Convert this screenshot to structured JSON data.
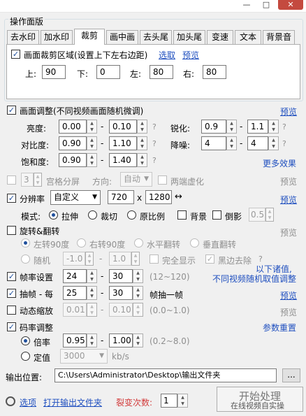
{
  "window": {
    "min": "—",
    "max": "□",
    "close": "✕"
  },
  "group_title": "操作面版",
  "tabs": [
    "去水印",
    "加水印",
    "裁剪",
    "画中画",
    "去头尾",
    "加头尾",
    "变速",
    "文本",
    "背景音"
  ],
  "crop": {
    "label": "画面裁剪区域(设置上下左右边距)",
    "select": "选取",
    "preview": "预览",
    "top_label": "上:",
    "top": "90",
    "bottom_label": "下:",
    "bottom": "0",
    "left_label": "左:",
    "left": "80",
    "right_label": "右:",
    "right": "80"
  },
  "adjust": {
    "label": "画面调整(不同视频画面随机微调)",
    "preview": "预览",
    "brightness_label": "亮度:",
    "brightness_min": "0.00",
    "brightness_max": "0.10",
    "contrast_label": "对比度:",
    "contrast_min": "0.90",
    "contrast_max": "1.10",
    "saturation_label": "饱和度:",
    "saturation_min": "0.90",
    "saturation_max": "1.40",
    "sharpen_label": "锐化:",
    "sharpen_min": "0.9",
    "sharpen_max": "1.1",
    "denoise_label": "降噪:",
    "denoise_min": "4",
    "denoise_max": "4",
    "more": "更多效果"
  },
  "grid": {
    "count": "3",
    "label": "宫格分屏",
    "dir_label": "方向:",
    "dir": "自动",
    "blur": "两端虚化",
    "preview": "预览"
  },
  "resolution": {
    "label": "分辨率",
    "mode": "自定义",
    "width": "720",
    "x": "x",
    "height": "1280",
    "swap": "↔",
    "preview": "预览",
    "mode_label": "模式:",
    "stretch": "拉伸",
    "crop": "裁切",
    "ratio": "原比例",
    "bg": "背景",
    "shadow": "倒影",
    "shadow_val": "0.5"
  },
  "rotate": {
    "label": "旋转&翻转",
    "preview": "预览",
    "left90": "左转90度",
    "right90": "右转90度",
    "hflip": "水平翻转",
    "vflip": "垂直翻转",
    "random": "随机",
    "rmin": "-1.0",
    "rmax": "1.0",
    "full": "完全显示",
    "blackedge": "黑边去除"
  },
  "note": {
    "line1": "以下诸值,",
    "line2": "不同视频随机取值调整"
  },
  "fps": {
    "label": "帧率设置",
    "min": "24",
    "max": "30",
    "hint": "(12~120)"
  },
  "frame": {
    "label": "抽帧 - 每",
    "min": "25",
    "max": "30",
    "unit": "帧抽一帧",
    "preview": "预览"
  },
  "zoom": {
    "label": "动态缩放",
    "min": "0.01",
    "max": "0.10",
    "hint": "(0.0~1.0)",
    "preview": "预览"
  },
  "bitrate": {
    "label": "码率调整",
    "reset": "参数重置",
    "mult_label": "倍率",
    "mult_min": "0.95",
    "mult_max": "1.00",
    "mult_hint": "(0.2~8.0)",
    "fixed_label": "定值",
    "fixed": "3000",
    "unit": "kb/s"
  },
  "output": {
    "label": "输出位置:",
    "path": "C:\\Users\\Administrator\\Desktop\\输出文件夹",
    "browse": "..."
  },
  "footer": {
    "options": "选项",
    "open": "打开输出文件夹",
    "split_label": "裂变次数:",
    "split": "1",
    "start": "开始处理",
    "watermark": "在线视频自实操"
  }
}
